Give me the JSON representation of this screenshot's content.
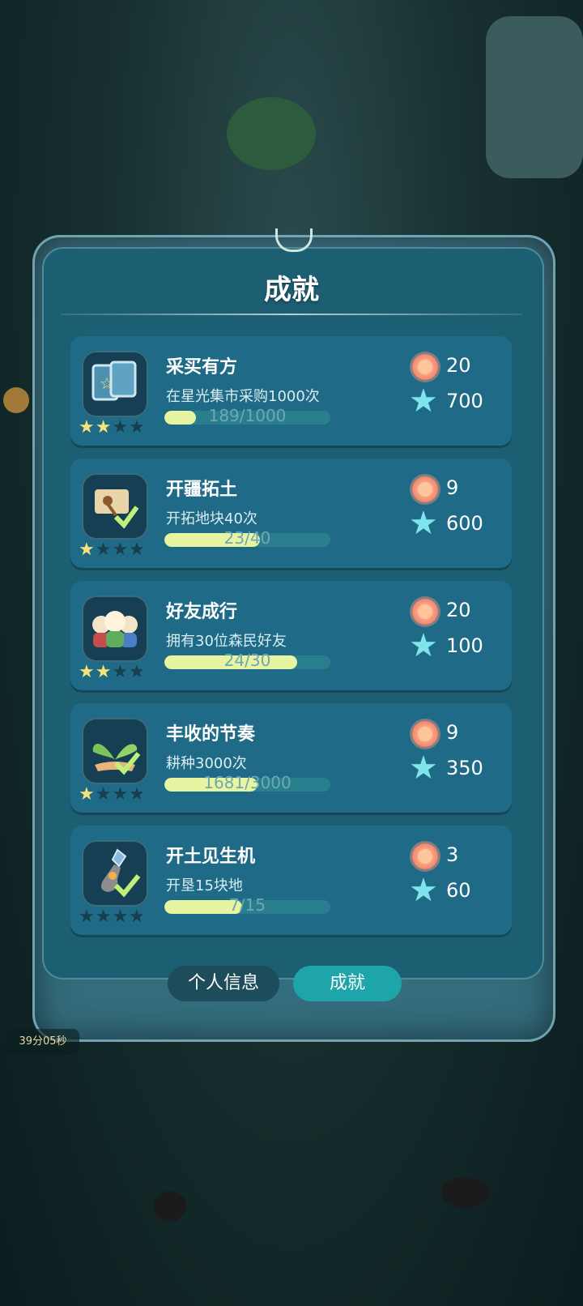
{
  "title": "成就",
  "achievements": [
    {
      "name": "采买有方",
      "desc": "在星光集市采购1000次",
      "progress_text": "189/1000",
      "progress": 0.189,
      "stars_filled": 2,
      "stars_total": 4,
      "icon": "cards-icon",
      "reward_flower": "20",
      "reward_star": "700"
    },
    {
      "name": "开疆拓土",
      "desc": "开拓地块40次",
      "progress_text": "23/40",
      "progress": 0.575,
      "stars_filled": 1,
      "stars_total": 4,
      "icon": "sign-shovel-icon",
      "reward_flower": "9",
      "reward_star": "600"
    },
    {
      "name": "好友成行",
      "desc": "拥有30位森民好友",
      "progress_text": "24/30",
      "progress": 0.8,
      "stars_filled": 2,
      "stars_total": 4,
      "icon": "friends-icon",
      "reward_flower": "20",
      "reward_star": "100"
    },
    {
      "name": "丰收的节奏",
      "desc": "耕种3000次",
      "progress_text": "1681/3000",
      "progress": 0.56,
      "stars_filled": 1,
      "stars_total": 4,
      "icon": "sprout-icon",
      "reward_flower": "9",
      "reward_star": "350"
    },
    {
      "name": "开土见生机",
      "desc": "开垦15块地",
      "progress_text": "7/15",
      "progress": 0.467,
      "stars_filled": 0,
      "stars_total": 4,
      "icon": "shovel-icon",
      "reward_flower": "3",
      "reward_star": "60"
    }
  ],
  "tabs": {
    "info": "个人信息",
    "achievements": "成就"
  },
  "timer": "39分05秒",
  "colors": {
    "accent": "#1ea5aa",
    "progress": "#e7f4a2",
    "star": "#f6e27a"
  }
}
